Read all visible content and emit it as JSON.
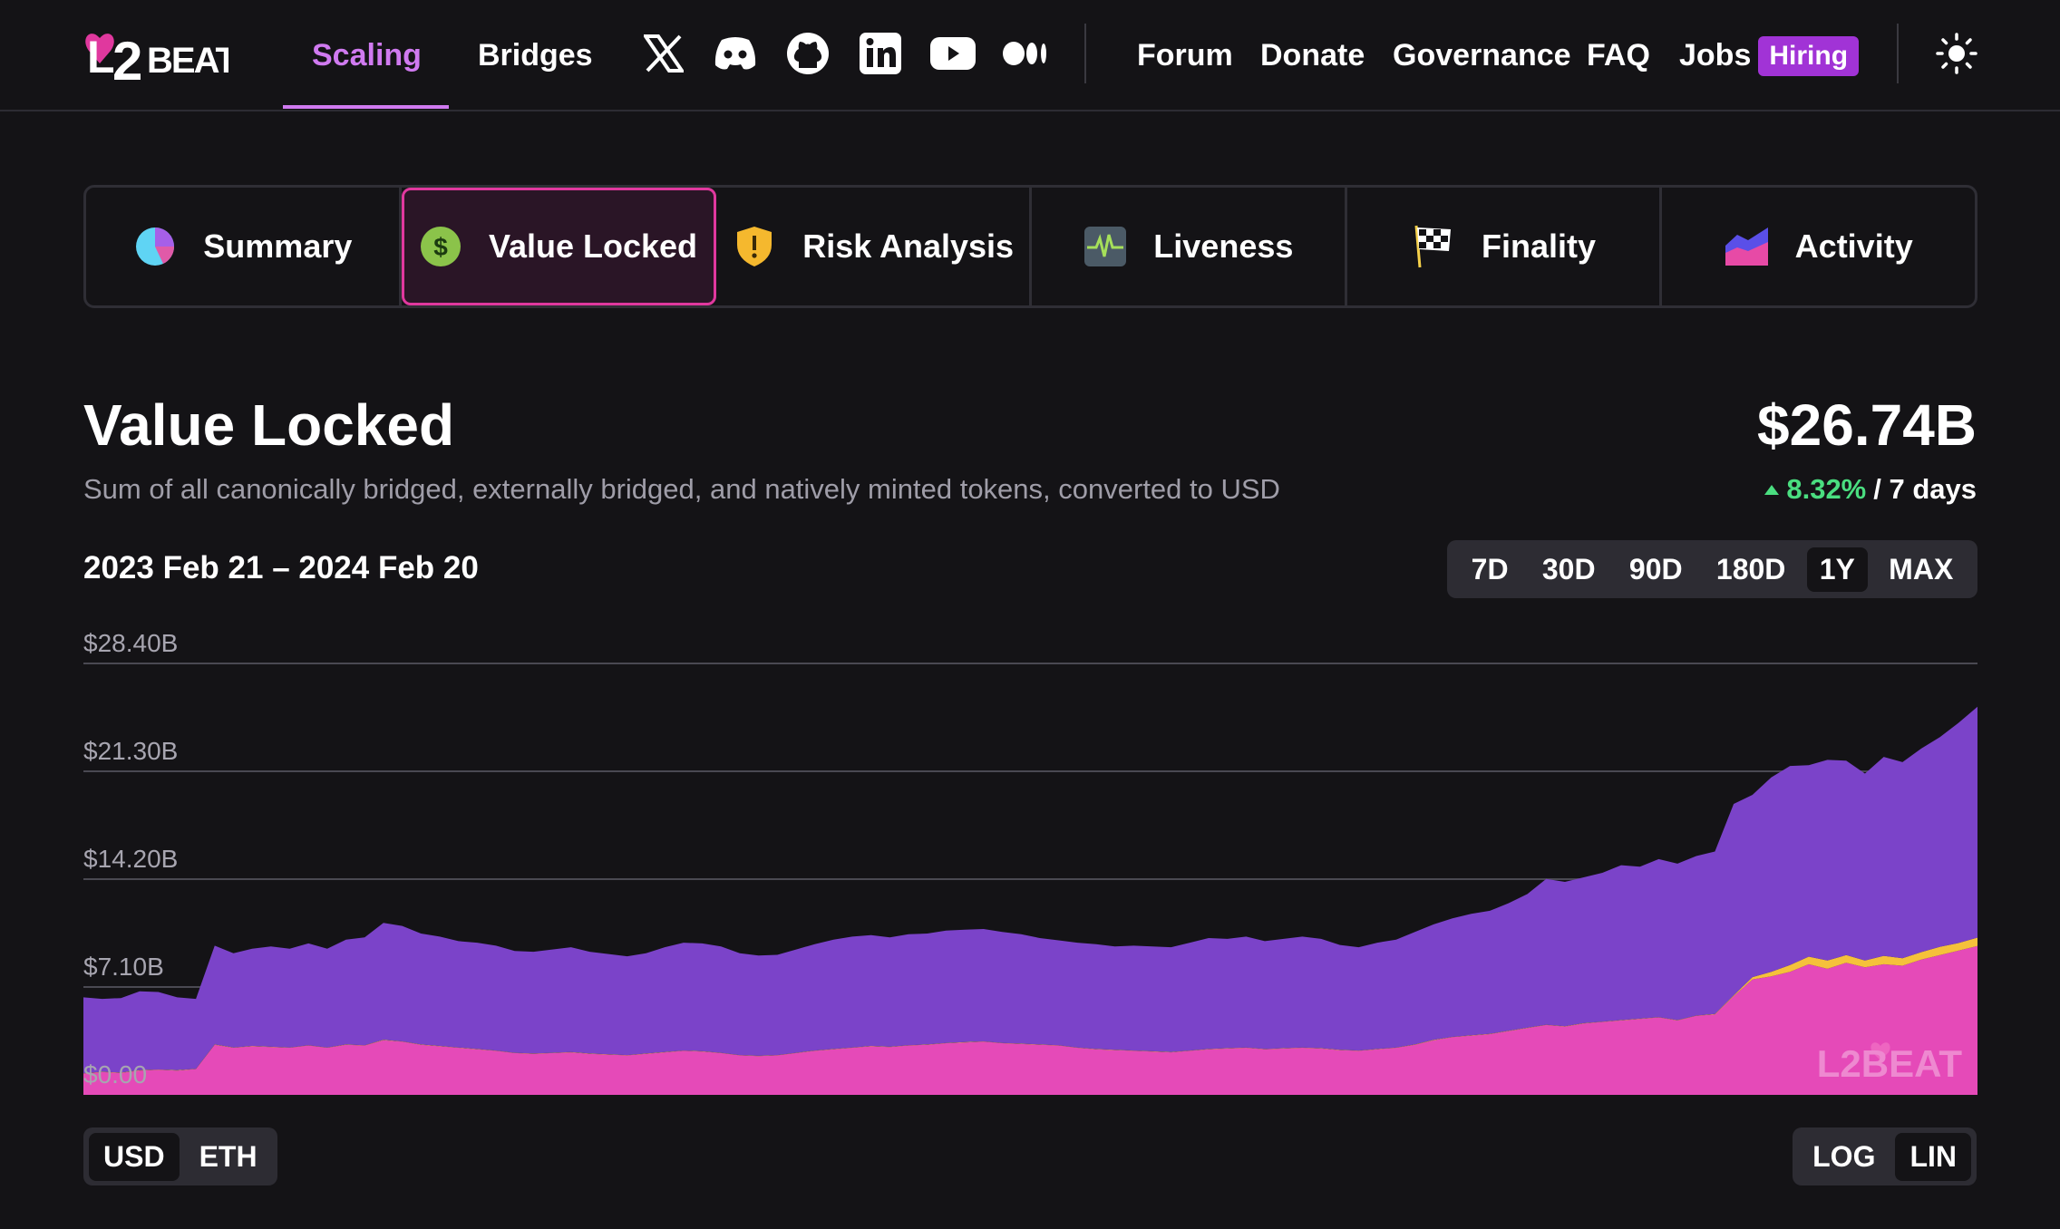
{
  "nav": {
    "logo_text": "L2BEAT",
    "links": [
      {
        "label": "Scaling"
      },
      {
        "label": "Bridges"
      }
    ],
    "social_icons": [
      "x-icon",
      "discord-icon",
      "github-icon",
      "linkedin-icon",
      "youtube-icon",
      "medium-icon"
    ],
    "right_links": [
      {
        "label": "Forum"
      },
      {
        "label": "Donate"
      },
      {
        "label": "Governance"
      },
      {
        "label": "FAQ"
      },
      {
        "label": "Jobs"
      }
    ],
    "hiring_badge": "Hiring",
    "active_link": "Scaling",
    "accent_color": "#d07af0"
  },
  "tabs": [
    {
      "label": "Summary",
      "icon": "pie-chart-icon"
    },
    {
      "label": "Value Locked",
      "icon": "dollar-coin-icon"
    },
    {
      "label": "Risk Analysis",
      "icon": "shield-warning-icon"
    },
    {
      "label": "Liveness",
      "icon": "heartbeat-icon"
    },
    {
      "label": "Finality",
      "icon": "checkered-flag-icon"
    },
    {
      "label": "Activity",
      "icon": "area-chart-icon"
    }
  ],
  "active_tab": "Value Locked",
  "header": {
    "title": "Value Locked",
    "description": "Sum of all canonically bridged, externally bridged, and natively minted tokens, converted to USD",
    "total_value": "$26.74B",
    "change_pct": "8.32%",
    "change_period": "/ 7 days",
    "change_color": "#4ade80"
  },
  "date_range": "2023 Feb 21 – 2024 Feb 20",
  "range_options": [
    "7D",
    "30D",
    "90D",
    "180D",
    "1Y",
    "MAX"
  ],
  "range_selected": "1Y",
  "currency_options": [
    "USD",
    "ETH"
  ],
  "currency_selected": "USD",
  "scale_options": [
    "LOG",
    "LIN"
  ],
  "scale_selected": "LIN",
  "chart_data": {
    "type": "area",
    "stacked": true,
    "x_start": "2023 Feb 21",
    "x_end": "2024 Feb 20",
    "ylim": [
      0,
      28.4
    ],
    "y_ticks": [
      "$0.00",
      "$7.10B",
      "$14.20B",
      "$21.30B",
      "$28.40B"
    ],
    "y_tick_values": [
      0,
      7.1,
      14.2,
      21.3,
      28.4
    ],
    "grid": true,
    "watermark": "L2BEAT",
    "series": [
      {
        "color": "#e54ab8",
        "values": [
          1.4,
          1.5,
          1.45,
          1.6,
          1.65,
          1.6,
          1.7,
          3.3,
          3.1,
          3.2,
          3.15,
          3.1,
          3.25,
          3.1,
          3.3,
          3.25,
          3.6,
          3.5,
          3.3,
          3.2,
          3.1,
          3.0,
          2.9,
          2.75,
          2.7,
          2.75,
          2.8,
          2.7,
          2.65,
          2.6,
          2.7,
          2.8,
          2.9,
          2.85,
          2.75,
          2.6,
          2.55,
          2.6,
          2.75,
          2.9,
          3.0,
          3.1,
          3.2,
          3.15,
          3.25,
          3.3,
          3.4,
          3.45,
          3.5,
          3.4,
          3.35,
          3.3,
          3.25,
          3.1,
          3.0,
          2.95,
          2.9,
          2.85,
          2.8,
          2.9,
          3.0,
          3.05,
          3.1,
          3.0,
          3.05,
          3.1,
          3.05,
          2.95,
          2.9,
          3.0,
          3.1,
          3.3,
          3.6,
          3.8,
          3.9,
          4.0,
          4.2,
          4.4,
          4.6,
          4.5,
          4.7,
          4.8,
          4.9,
          5.0,
          5.1,
          4.9,
          5.2,
          5.3,
          6.5,
          7.6,
          7.8,
          8.1,
          8.6,
          8.3,
          8.7,
          8.4,
          8.6,
          8.5,
          8.9,
          9.2,
          9.5,
          9.8
        ]
      },
      {
        "color": "#f5c13b",
        "values": [
          0.02,
          0.02,
          0.02,
          0.02,
          0.02,
          0.02,
          0.02,
          0.02,
          0.02,
          0.02,
          0.02,
          0.02,
          0.02,
          0.02,
          0.02,
          0.02,
          0.02,
          0.02,
          0.02,
          0.02,
          0.02,
          0.02,
          0.02,
          0.02,
          0.02,
          0.02,
          0.02,
          0.02,
          0.02,
          0.02,
          0.02,
          0.02,
          0.02,
          0.02,
          0.02,
          0.02,
          0.02,
          0.02,
          0.02,
          0.02,
          0.02,
          0.02,
          0.02,
          0.02,
          0.02,
          0.02,
          0.02,
          0.02,
          0.02,
          0.02,
          0.02,
          0.02,
          0.02,
          0.02,
          0.02,
          0.02,
          0.02,
          0.02,
          0.02,
          0.02,
          0.02,
          0.02,
          0.02,
          0.02,
          0.02,
          0.02,
          0.02,
          0.02,
          0.02,
          0.02,
          0.02,
          0.02,
          0.02,
          0.02,
          0.02,
          0.02,
          0.02,
          0.02,
          0.02,
          0.02,
          0.02,
          0.02,
          0.02,
          0.02,
          0.02,
          0.02,
          0.02,
          0.02,
          0.05,
          0.15,
          0.3,
          0.45,
          0.5,
          0.55,
          0.5,
          0.45,
          0.55,
          0.5,
          0.5,
          0.55,
          0.5,
          0.55
        ]
      },
      {
        "color": "#7b43c9",
        "values": [
          5.0,
          4.8,
          4.9,
          5.2,
          5.1,
          4.8,
          4.6,
          6.5,
          6.2,
          6.4,
          6.6,
          6.5,
          6.7,
          6.5,
          6.9,
          7.1,
          7.7,
          7.6,
          7.3,
          7.2,
          7.0,
          7.0,
          6.9,
          6.7,
          6.7,
          6.8,
          6.9,
          6.7,
          6.6,
          6.5,
          6.6,
          6.9,
          7.1,
          7.1,
          7.0,
          6.7,
          6.6,
          6.6,
          6.8,
          7.0,
          7.2,
          7.3,
          7.3,
          7.2,
          7.3,
          7.3,
          7.4,
          7.4,
          7.4,
          7.3,
          7.2,
          7.0,
          6.9,
          6.9,
          6.9,
          6.8,
          6.9,
          6.9,
          6.9,
          7.1,
          7.3,
          7.2,
          7.3,
          7.1,
          7.2,
          7.3,
          7.2,
          6.9,
          6.8,
          7.0,
          7.1,
          7.4,
          7.6,
          7.8,
          8.0,
          8.1,
          8.4,
          8.8,
          9.6,
          9.5,
          9.6,
          9.8,
          10.2,
          10.0,
          10.4,
          10.3,
          10.5,
          10.7,
          12.6,
          12.0,
          12.8,
          13.1,
          12.6,
          13.2,
          12.8,
          12.3,
          13.1,
          12.9,
          13.4,
          13.8,
          14.5,
          15.2
        ]
      }
    ]
  }
}
